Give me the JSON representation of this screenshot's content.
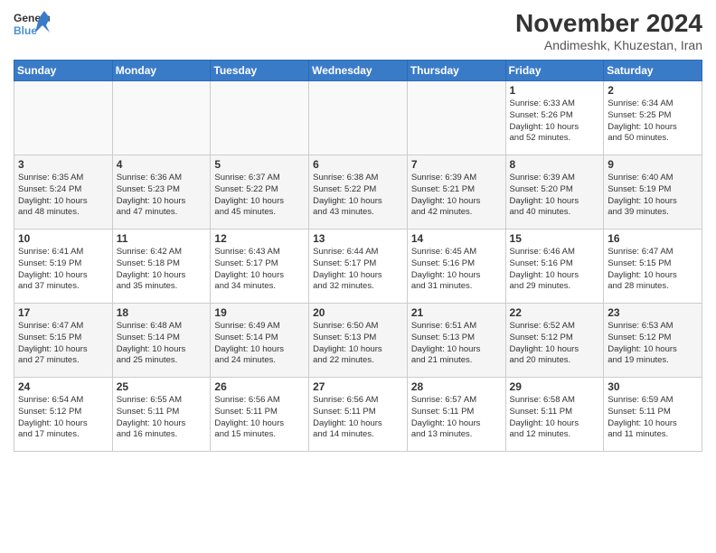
{
  "logo": {
    "line1": "General",
    "line2": "Blue"
  },
  "title": "November 2024",
  "subtitle": "Andimeshk, Khuzestan, Iran",
  "weekdays": [
    "Sunday",
    "Monday",
    "Tuesday",
    "Wednesday",
    "Thursday",
    "Friday",
    "Saturday"
  ],
  "weeks": [
    [
      {
        "day": "",
        "info": ""
      },
      {
        "day": "",
        "info": ""
      },
      {
        "day": "",
        "info": ""
      },
      {
        "day": "",
        "info": ""
      },
      {
        "day": "",
        "info": ""
      },
      {
        "day": "1",
        "info": "Sunrise: 6:33 AM\nSunset: 5:26 PM\nDaylight: 10 hours\nand 52 minutes."
      },
      {
        "day": "2",
        "info": "Sunrise: 6:34 AM\nSunset: 5:25 PM\nDaylight: 10 hours\nand 50 minutes."
      }
    ],
    [
      {
        "day": "3",
        "info": "Sunrise: 6:35 AM\nSunset: 5:24 PM\nDaylight: 10 hours\nand 48 minutes."
      },
      {
        "day": "4",
        "info": "Sunrise: 6:36 AM\nSunset: 5:23 PM\nDaylight: 10 hours\nand 47 minutes."
      },
      {
        "day": "5",
        "info": "Sunrise: 6:37 AM\nSunset: 5:22 PM\nDaylight: 10 hours\nand 45 minutes."
      },
      {
        "day": "6",
        "info": "Sunrise: 6:38 AM\nSunset: 5:22 PM\nDaylight: 10 hours\nand 43 minutes."
      },
      {
        "day": "7",
        "info": "Sunrise: 6:39 AM\nSunset: 5:21 PM\nDaylight: 10 hours\nand 42 minutes."
      },
      {
        "day": "8",
        "info": "Sunrise: 6:39 AM\nSunset: 5:20 PM\nDaylight: 10 hours\nand 40 minutes."
      },
      {
        "day": "9",
        "info": "Sunrise: 6:40 AM\nSunset: 5:19 PM\nDaylight: 10 hours\nand 39 minutes."
      }
    ],
    [
      {
        "day": "10",
        "info": "Sunrise: 6:41 AM\nSunset: 5:19 PM\nDaylight: 10 hours\nand 37 minutes."
      },
      {
        "day": "11",
        "info": "Sunrise: 6:42 AM\nSunset: 5:18 PM\nDaylight: 10 hours\nand 35 minutes."
      },
      {
        "day": "12",
        "info": "Sunrise: 6:43 AM\nSunset: 5:17 PM\nDaylight: 10 hours\nand 34 minutes."
      },
      {
        "day": "13",
        "info": "Sunrise: 6:44 AM\nSunset: 5:17 PM\nDaylight: 10 hours\nand 32 minutes."
      },
      {
        "day": "14",
        "info": "Sunrise: 6:45 AM\nSunset: 5:16 PM\nDaylight: 10 hours\nand 31 minutes."
      },
      {
        "day": "15",
        "info": "Sunrise: 6:46 AM\nSunset: 5:16 PM\nDaylight: 10 hours\nand 29 minutes."
      },
      {
        "day": "16",
        "info": "Sunrise: 6:47 AM\nSunset: 5:15 PM\nDaylight: 10 hours\nand 28 minutes."
      }
    ],
    [
      {
        "day": "17",
        "info": "Sunrise: 6:47 AM\nSunset: 5:15 PM\nDaylight: 10 hours\nand 27 minutes."
      },
      {
        "day": "18",
        "info": "Sunrise: 6:48 AM\nSunset: 5:14 PM\nDaylight: 10 hours\nand 25 minutes."
      },
      {
        "day": "19",
        "info": "Sunrise: 6:49 AM\nSunset: 5:14 PM\nDaylight: 10 hours\nand 24 minutes."
      },
      {
        "day": "20",
        "info": "Sunrise: 6:50 AM\nSunset: 5:13 PM\nDaylight: 10 hours\nand 22 minutes."
      },
      {
        "day": "21",
        "info": "Sunrise: 6:51 AM\nSunset: 5:13 PM\nDaylight: 10 hours\nand 21 minutes."
      },
      {
        "day": "22",
        "info": "Sunrise: 6:52 AM\nSunset: 5:12 PM\nDaylight: 10 hours\nand 20 minutes."
      },
      {
        "day": "23",
        "info": "Sunrise: 6:53 AM\nSunset: 5:12 PM\nDaylight: 10 hours\nand 19 minutes."
      }
    ],
    [
      {
        "day": "24",
        "info": "Sunrise: 6:54 AM\nSunset: 5:12 PM\nDaylight: 10 hours\nand 17 minutes."
      },
      {
        "day": "25",
        "info": "Sunrise: 6:55 AM\nSunset: 5:11 PM\nDaylight: 10 hours\nand 16 minutes."
      },
      {
        "day": "26",
        "info": "Sunrise: 6:56 AM\nSunset: 5:11 PM\nDaylight: 10 hours\nand 15 minutes."
      },
      {
        "day": "27",
        "info": "Sunrise: 6:56 AM\nSunset: 5:11 PM\nDaylight: 10 hours\nand 14 minutes."
      },
      {
        "day": "28",
        "info": "Sunrise: 6:57 AM\nSunset: 5:11 PM\nDaylight: 10 hours\nand 13 minutes."
      },
      {
        "day": "29",
        "info": "Sunrise: 6:58 AM\nSunset: 5:11 PM\nDaylight: 10 hours\nand 12 minutes."
      },
      {
        "day": "30",
        "info": "Sunrise: 6:59 AM\nSunset: 5:11 PM\nDaylight: 10 hours\nand 11 minutes."
      }
    ]
  ]
}
